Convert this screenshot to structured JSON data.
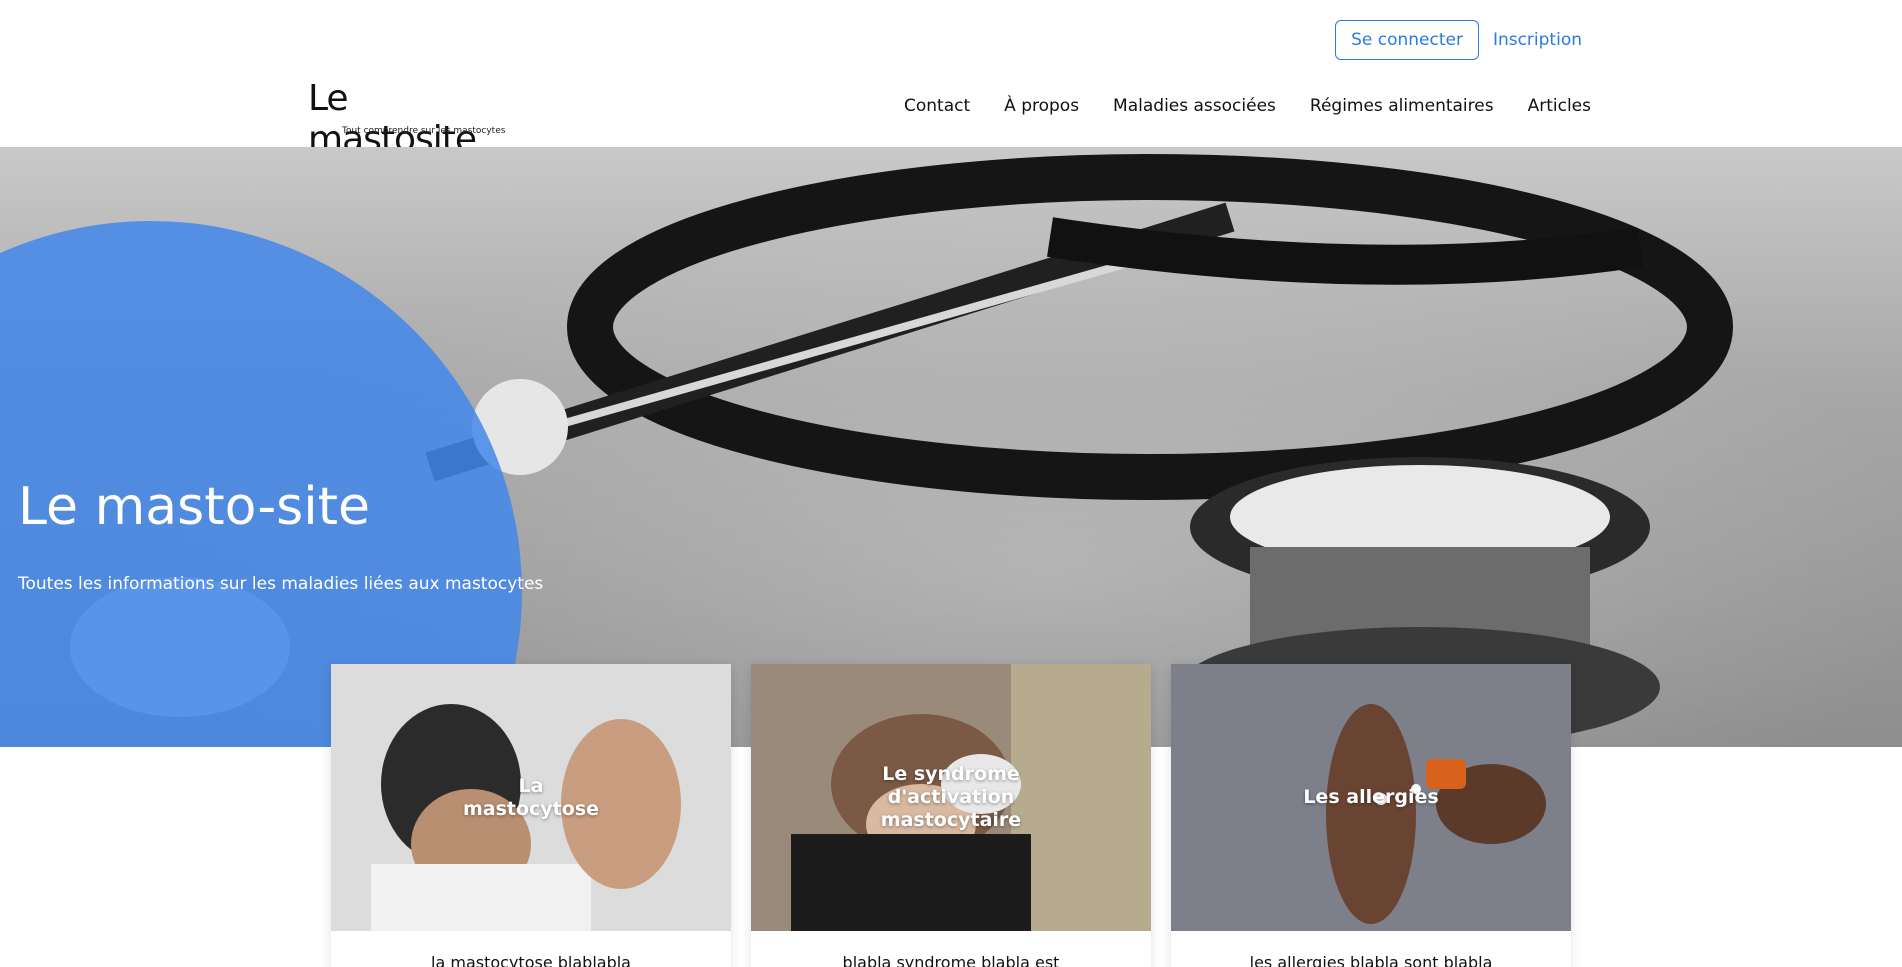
{
  "auth": {
    "login_label": "Se connecter",
    "signup_label": "Inscription"
  },
  "header": {
    "logo_text": "Le mastosite",
    "logo_tagline": "Tout comprendre sur les mastocytes",
    "nav": [
      "Contact",
      "À propos",
      "Maladies associées",
      "Régimes alimentaires",
      "Articles"
    ]
  },
  "hero": {
    "title": "Le masto-site",
    "subtitle": "Toutes les informations sur les maladies liées aux mastocytes"
  },
  "cards": [
    {
      "title": "La mastocytose",
      "excerpt": "la mastocytose blablabla"
    },
    {
      "title": "Le syndrome d'activation mastocytaire",
      "excerpt": "blabla syndrome blabla est"
    },
    {
      "title": "Les allergies",
      "excerpt": "les allergies blabla sont blabla"
    }
  ],
  "colors": {
    "accent": "#2a7ae2",
    "hero_circle": "#4287eb"
  }
}
